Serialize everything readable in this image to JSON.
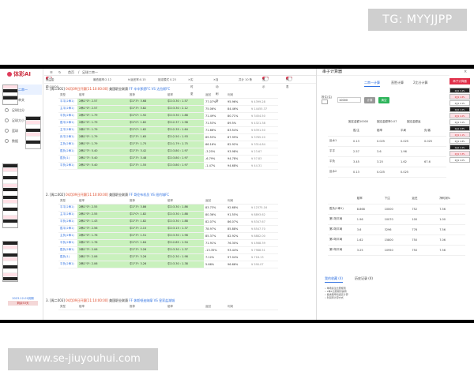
{
  "watermarks": {
    "top": "TG: MYYJJPP",
    "bottom": "www.se-jiuyouhui.com"
  },
  "app": {
    "logo": "体彩AI",
    "topbar": {
      "home": "首页",
      "sep": "/",
      "crumb": "足球二串一",
      "refresh_icon": "refresh-icon",
      "menu_icon": "menu-icon"
    },
    "sidebar": {
      "items": [
        {
          "label": "足球二串一",
          "active": true
        },
        {
          "label": "足球单关",
          "active": false
        },
        {
          "label": "足球比分",
          "active": false
        },
        {
          "label": "足球大小",
          "active": false
        },
        {
          "label": "篮球",
          "active": false
        },
        {
          "label": "数据",
          "active": false
        }
      ],
      "footer_1": "2023-12-01到期",
      "footer_2": "剩余53天"
    },
    "filterbar": {
      "amount_label": "投注金额:10000",
      "min_odds_label": "最低赔率:2.12",
      "rate_label": "hi返还率:0.15",
      "settle_label": "锁定模式 0.23",
      "switch_1": "实时更新",
      "switch_2": "自动刷新",
      "count_label": "共计 10 条",
      "switch_3": "显示",
      "switch_4": "列表"
    },
    "matches": [
      {
        "no": "1.",
        "tag": "[周二001]",
        "time": "04月09日开赛[11:10:00:00]",
        "league": "美国职业联赛",
        "teams": "FF 辛辛那提FC VS 达拉斯FC",
        "headers": [
          "类型",
          "赔率",
          "",
          "推荐",
          "赔率",
          "返回",
          "利润"
        ],
        "rows": [
          [
            "平平(2串1)",
            "2串1\"0\": 2.57",
            "",
            "中2\"3\": 3.68",
            "中2:3.30 : 1.57",
            "77.07%",
            "95.96%",
            "¥ 4399.28"
          ],
          [
            "主平(2串1)",
            "2串1\"0\": 2.57",
            "",
            "中2\"3\": 3.82",
            "中2:3.30 : 2.12",
            "75.06%",
            "84.46%",
            "¥ 14455.37"
          ],
          [
            "平负(2串1)",
            "2串1\"0\": 1.79",
            "",
            "中2\"0\": 1.92",
            "中2:3.30 : 1.88",
            "71.49%",
            "80.71%",
            "¥ 3454.50"
          ],
          [
            "胜平(2串1)",
            "2串1\"0\": 1.79",
            "",
            "中2\"0\": 1.82",
            "中2:2.37 : 1.98",
            "71.53%",
            "89.5%",
            "¥ 4321.38"
          ],
          [
            "主平(2串1)",
            "2串1\"3\": 1.79",
            "",
            "中2\"0\": 1.62",
            "中2:2.35 : 1.64",
            "71.66%",
            "83.54%",
            "¥ 6391.50"
          ],
          [
            "负平(2串1)",
            "2串1\"0\": 1.79",
            "",
            "中2\"3\": 1.65",
            "中2:2.50 : 1.93",
            "69.53%",
            "87.99%",
            "¥ 3765.20"
          ],
          [
            "主负(2串1)",
            "2串1\"0\": 1.79",
            "",
            "中2\"3\": 1.75",
            "中2:1.79 : 1.75",
            "66.16%",
            "82.92%",
            "¥ 3314.84"
          ],
          [
            "胜负(2串1)",
            "2串1\"3\": 5.40",
            "",
            "中2\"3\": 3.42",
            "中2:3.80 : 1.97",
            "-3.25%",
            "93.98%",
            "¥ 23.67"
          ],
          [
            "胜负(1)",
            "2串1\"3\": 5.40",
            "",
            "中2\"3\": 3.48",
            "中2:3.80 : 1.97",
            "-6.79%",
            "94.78%",
            "¥ 57.83"
          ],
          [
            "平负(2串1)",
            "2串1\"0\": 5.40",
            "",
            "中2\"3\": 1.55",
            "中2:3.80 : 1.97",
            "-1.47%",
            "94.68%",
            "¥ 44.31"
          ]
        ]
      },
      {
        "no": "2.",
        "tag": "[周二002]",
        "time": "04月09日开赛[11:10:00:00]",
        "league": "美国职业联赛",
        "teams": "FF 哥伦布机员 VS 纽约城FC",
        "headers": [
          "类型",
          "赔率",
          "",
          "推荐",
          "赔率",
          "返回",
          "利润"
        ],
        "rows": [
          [
            "平平(2串1)",
            "2串1\"0\": 2.55",
            "",
            "中2\"3\": 3.86",
            "中2:3.30 : 1.86",
            "83.73%",
            "92.68%",
            "¥ 12375.16"
          ],
          [
            "主平(2串1)",
            "2串1\"0\": 2.55",
            "",
            "中2\"0\": 1.82",
            "中2:3.30 : 1.88",
            "80.36%",
            "91.55%",
            "¥ 8893.62"
          ],
          [
            "平负(2串1)",
            "2串1\"0\": 1.43",
            "",
            "中2\"3\": 1.82",
            "中2:3.30 : 1.88",
            "82.07%",
            "86.07%",
            "¥ 8347.67"
          ],
          [
            "胜平(2串1)",
            "2串1\"3\": 2.56",
            "",
            "中2\"3\": 2.15",
            "中2:3.15 : 1.37",
            "78.97%",
            "85.88%",
            "¥ 8547.70"
          ],
          [
            "主负(2串1)",
            "2串1\"0\": 1.76",
            "",
            "中2\"3\": 1.51",
            "中2:3.30 : 1.98",
            "85.37%",
            "82.92%",
            "¥ 8882.00"
          ],
          [
            "平负(2串1)",
            "2串1\"0\": 1.76",
            "",
            "中2\"0\": 1.64",
            "中2:2.85 : 1.94",
            "71.91%",
            "76.30%",
            "¥ 4568.39"
          ],
          [
            "胜负(2串1)",
            "2串1\"3\": 2.06",
            "",
            "中2\"3\": 3.26",
            "中2:3.30 : 1.37",
            "-13.35%",
            "93.44%",
            "¥ 7988.51"
          ],
          [
            "胜负(1)",
            "2串1\"3\": 2.06",
            "",
            "中2\"3\": 3.26",
            "中2:2.30 : 1.98",
            "7.12%",
            "97.04%",
            "¥ 718.13"
          ],
          [
            "平负(2串1)",
            "2串1\"0\": 2.06",
            "",
            "中2\"3\": 3.26",
            "中2:3.30 : 1.38",
            "5.66%",
            "96.66%",
            "¥ 590.07"
          ]
        ]
      },
      {
        "no": "3.",
        "tag": "[周二003]",
        "time": "04月09日开赛[11:10:00:00]",
        "league": "美国职业联赛",
        "teams": "FF 休斯顿迪纳摩 VS 皇家盐湖城",
        "headers": [
          "类型",
          "赔率",
          "",
          "推荐",
          "赔率",
          "返回",
          "利润"
        ]
      }
    ],
    "right_panel": {
      "title": "串子计算器",
      "close": "×",
      "tabs": [
        "二串一计算",
        "直胜计算",
        "2比分计算"
      ],
      "side_button": "串子计算器",
      "side_tiny": [
        "2串1 3.4%",
        "2串1 1.8%",
        "2串1 2.1%",
        "2串1 1.6%",
        "2串1 4.2%",
        "2串1 3.1%",
        "2串1 0.8%",
        "2串1 1.1%",
        "2串1 1.8%",
        "2串1 2.4%",
        "2串1 3.3%",
        "2串1 1.0%"
      ],
      "invest_label": "投注(注)",
      "invest_value": "10000",
      "btn_calc": "计算",
      "btn_clear": "清空",
      "amount_line": "固定金额10000",
      "amount_line2": "固定金额率0.07",
      "amount_line3": "固定金额返",
      "calc_headers": [
        "",
        "胜/主",
        "赔率",
        "平局",
        "负/客"
      ],
      "calc_rows": [
        [
          "反水1",
          "0.13",
          "0.025",
          "0.025",
          "0.025"
        ],
        [
          "平平",
          "2.57",
          "3.6",
          "1.96",
          ""
        ],
        [
          "平负",
          "3.45",
          "3.25",
          "1.62",
          "67.6"
        ],
        [
          "反水2",
          "0.13",
          "0.025",
          "0.025",
          ""
        ]
      ],
      "result_headers": [
        "",
        "赔率",
        "下注",
        "返还",
        "净利润%"
      ],
      "result_rows": [
        [
          "胜负(2串1)",
          "8.868",
          "10000",
          "752",
          "7.56"
        ],
        [
          "第1场平局",
          "1.96",
          "10070",
          "100",
          "1.00"
        ],
        [
          "第2场平局",
          "3.6",
          "3296",
          "776",
          "7.56"
        ],
        [
          "第2场平局",
          "1.62",
          "15800",
          "750",
          "7.06"
        ],
        [
          "第2场平局",
          "3.25",
          "10950",
          "750",
          "7.56"
        ]
      ],
      "bottom_tabs": [
        "我的收藏 (4)",
        "历史记录 (4)"
      ],
      "list": [
        "单场投注比赛规则",
        "2串1比赛规则说明",
        "各类赔率和返还计算",
        "利润率计算方式"
      ]
    }
  }
}
